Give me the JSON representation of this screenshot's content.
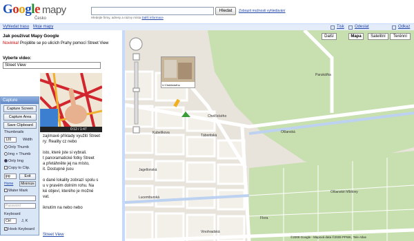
{
  "header": {
    "logo_text": "Google",
    "logo_suffix": "mapy",
    "country": "Česko",
    "search_value": "",
    "search_hint": "Hledejte firmy, adresy a názvy místa",
    "search_hint_link": "Další informace",
    "search_button": "Hledat",
    "advanced_link": "Zobrazit možnosti vyhledávání"
  },
  "nav": {
    "route_link": "Vyhledat trasu",
    "my_maps_link": "Moje mapy",
    "print_link": "Tisk",
    "send_link": "Odeslat",
    "link_link": "Odkaz"
  },
  "sidebar": {
    "title": "Jak používat Mapy Google",
    "news_label": "Novinka!",
    "news_text": " Projděte se po ulicích Prahy pomocí Street View",
    "select_label": "Vyberte video:",
    "select_value": "Street View",
    "video_time": "0:12 / 1:47",
    "paragraph_lines": [
      "zajímavé příklady využití Street",
      "ry: Reality cz nebo",
      "",
      "isto, které jste si vybrali.",
      "t panoramatické fotky Street",
      "a přetáhněte jej na místo,",
      "it. Dostupné jsou",
      "",
      "o dané lokality zobrazí spolu s",
      "u v pravém dolním rohu. Na",
      "ké objeví, kterého je možné",
      "vat.",
      "",
      "iknutím na nebo nebo"
    ],
    "street_view_link": "Street View"
  },
  "capture": {
    "title": "Capture",
    "btn_capture_screen": "Capture Screen",
    "btn_capture_area": "Capture Area",
    "btn_save_clipboard": "Save Clipboard",
    "thumbnails_label": "Thumbnails",
    "width_value": "120",
    "width_label": "Width",
    "opt_only_thumb": "Only Thumb",
    "opt_img_thumb": "Img + Thumb",
    "opt_only_img": "Only Img",
    "copy_to_clip": "Copy to Clip.",
    "format_value": "jpg",
    "exit_button": "Exit",
    "home_link": "Home",
    "minimize_button": "Minimize",
    "watermark_label": "Water Mark",
    "password_placeholder": "Password",
    "keyboard_label": "Keyboard",
    "ctrl_value": "Ctrl",
    "key_value": "J, K",
    "hook_keyboard": "Hook Keyboard"
  },
  "map": {
    "btn_more": "Další",
    "btn_map": "Mapa",
    "btn_satellite": "Satelitní",
    "btn_terrain": "Terénní",
    "labels": [
      {
        "text": "Parukářka",
        "cls": "lbl-parukarka"
      },
      {
        "text": "Chelčického",
        "cls": "lbl-chelc"
      },
      {
        "text": "Olšanská",
        "cls": "lbl-olsanska"
      },
      {
        "text": "Olšanské hřbitovy",
        "cls": "lbl-hrbitovy"
      },
      {
        "text": "Táboritská",
        "cls": "lbl-tab"
      },
      {
        "text": "Kubelíkova",
        "cls": "lbl-kub"
      },
      {
        "text": "Lucemburská",
        "cls": "lbl-luc"
      },
      {
        "text": "Jagellonská",
        "cls": "lbl-jag"
      },
      {
        "text": "Vinohradská",
        "cls": "lbl-vino"
      },
      {
        "text": "Flora",
        "cls": "lbl-flora"
      }
    ],
    "copyright": "©2009 Google - Mapová data ©2009 PPWK, Tele Atlas",
    "thumb_caption": "U Chelčického"
  }
}
